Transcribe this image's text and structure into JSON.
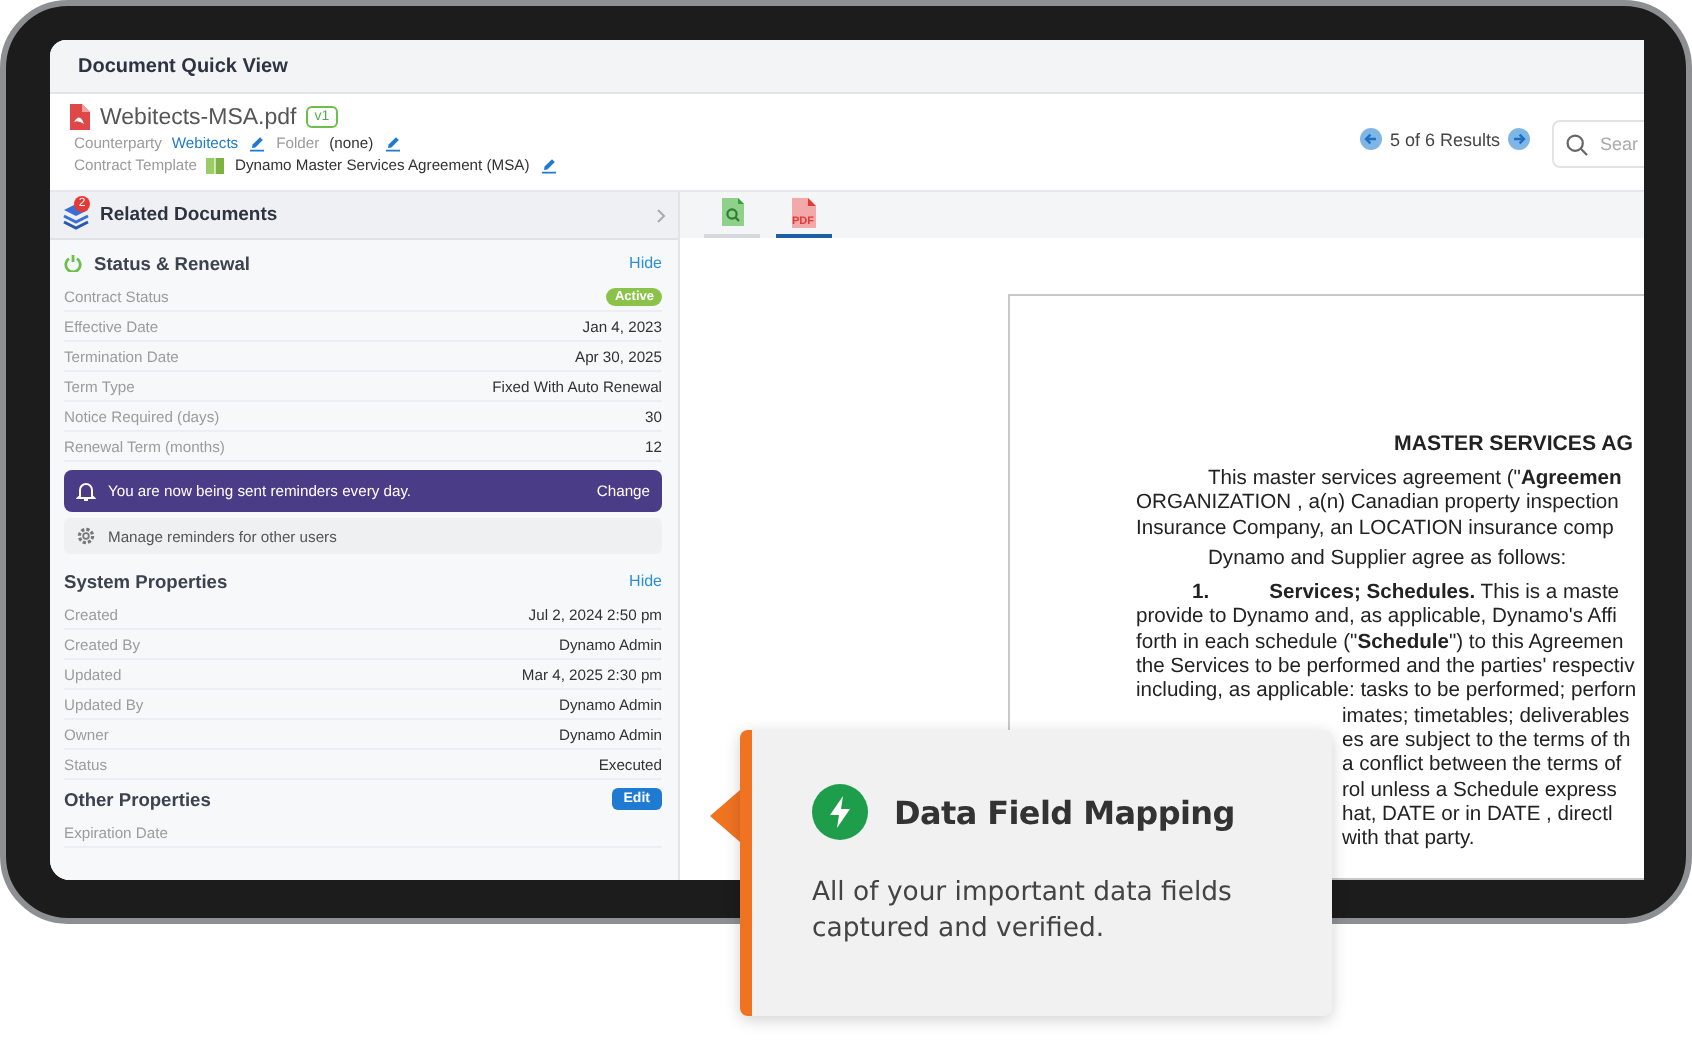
{
  "window": {
    "title": "Document Quick View"
  },
  "document": {
    "filename": "Webitects-MSA.pdf",
    "version": "v1",
    "fields": [
      {
        "label": "Counterparty",
        "value": "Webitects",
        "kind": "link",
        "editable": true
      },
      {
        "label": "Folder",
        "value": "(none)",
        "kind": "text",
        "editable": true
      }
    ],
    "template": {
      "label": "Contract Template",
      "value": "Dynamo Master Services Agreement (MSA)",
      "editable": true
    }
  },
  "results": {
    "text": "5 of 6 Results"
  },
  "search": {
    "placeholder": "Sear"
  },
  "related_documents": {
    "title": "Related Documents",
    "count": "2"
  },
  "sections": [
    {
      "kind": "status",
      "title": "Status & Renewal",
      "action": {
        "label": "Hide",
        "kind": "link"
      },
      "rows": [
        {
          "label": "Contract Status",
          "value": "Active",
          "kind": "badge"
        },
        {
          "label": "Effective Date",
          "value": "Jan 4, 2023",
          "kind": "text"
        },
        {
          "label": "Termination Date",
          "value": "Apr 30, 2025",
          "kind": "text"
        },
        {
          "label": "Term Type",
          "value": "Fixed With Auto Renewal",
          "kind": "text"
        },
        {
          "label": "Notice Required (days)",
          "value": "30",
          "kind": "text"
        },
        {
          "label": "Renewal Term (months)",
          "value": "12",
          "kind": "text"
        }
      ],
      "reminder": {
        "text": "You are now being sent reminders every day.",
        "action": "Change"
      },
      "manage": {
        "text": "Manage reminders for other users"
      }
    },
    {
      "kind": "plain",
      "title": "System Properties",
      "action": {
        "label": "Hide",
        "kind": "link"
      },
      "rows": [
        {
          "label": "Created",
          "value": "Jul 2, 2024 2:50 pm",
          "kind": "text"
        },
        {
          "label": "Created By",
          "value": "Dynamo Admin",
          "kind": "text"
        },
        {
          "label": "Updated",
          "value": "Mar 4, 2025 2:30 pm",
          "kind": "text"
        },
        {
          "label": "Updated By",
          "value": "Dynamo Admin",
          "kind": "text"
        },
        {
          "label": "Owner",
          "value": "Dynamo Admin",
          "kind": "text"
        },
        {
          "label": "Status",
          "value": "Executed",
          "kind": "text"
        }
      ]
    },
    {
      "kind": "plain",
      "title": "Other Properties",
      "action": {
        "label": "Edit",
        "kind": "button"
      },
      "rows": [
        {
          "label": "Expiration Date",
          "kind": "text"
        }
      ]
    }
  ],
  "viewer_tabs": [
    {
      "kind": "preview",
      "selected": false
    },
    {
      "kind": "pdf",
      "label": "PDF",
      "selected": true
    }
  ],
  "page": {
    "title": "MASTER SERVICES AG",
    "lines": [
      {
        "kind": "indent",
        "text": "This master services agreement (\"**Agreemen**"
      },
      {
        "kind": "plain",
        "text": "ORGANIZATION , a(n) Canadian property inspection"
      },
      {
        "kind": "plain",
        "text": "Insurance Company, an  LOCATION insurance comp"
      },
      {
        "kind": "indent",
        "text": "Dynamo and Supplier agree as follows:"
      },
      {
        "kind": "numbered",
        "number": "1.",
        "text": "**Services; Schedules.** This is a maste"
      },
      {
        "kind": "plain",
        "text": "provide to Dynamo and, as applicable, Dynamo's Affi"
      },
      {
        "kind": "plain",
        "text": "forth in each schedule (\"**Schedule**\") to this Agreemen"
      },
      {
        "kind": "plain",
        "text": "the Services to be performed and the parties' respectiv"
      },
      {
        "kind": "plain",
        "text": "including, as applicable: tasks to be performed; perforn"
      },
      {
        "kind": "partial",
        "text": "imates; timetables; deliverables"
      },
      {
        "kind": "partial",
        "text": "es are subject to the terms of th"
      },
      {
        "kind": "partial",
        "text": "a conflict between the terms of"
      },
      {
        "kind": "partial",
        "text": "rol unless a Schedule express"
      },
      {
        "kind": "partial",
        "text": "hat, DATE or in DATE , directl"
      },
      {
        "kind": "partial",
        "text": "with that party."
      }
    ]
  },
  "callout": {
    "title": "Data Field Mapping",
    "text": "All of your important data fields captured and verified."
  }
}
